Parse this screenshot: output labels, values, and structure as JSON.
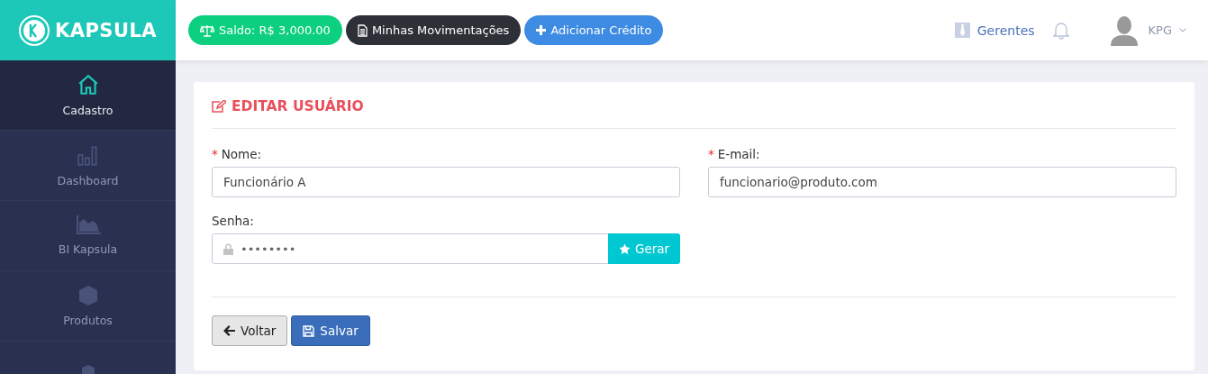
{
  "brand": {
    "name": "KAPSULA"
  },
  "header": {
    "buttons": [
      {
        "kind": "balance",
        "label": "Saldo: R$ 3,000.00"
      },
      {
        "kind": "statement",
        "label": "Minhas Movimentações"
      },
      {
        "kind": "credit",
        "label": "Adicionar Crédito"
      }
    ],
    "managers": "Gerentes",
    "user": "KPG"
  },
  "sidebar": {
    "items": [
      {
        "kind": "home",
        "label": "Cadastro",
        "selected": true
      },
      {
        "kind": "bars",
        "label": "Dashboard",
        "selected": false
      },
      {
        "kind": "area",
        "label": "BI Kapsula",
        "selected": false
      },
      {
        "kind": "cube",
        "label": "Produtos",
        "selected": false
      },
      {
        "kind": "cubes",
        "selected": false
      }
    ]
  },
  "form": {
    "title": "EDITAR USUÁRIO",
    "fields": [
      {
        "required_mark": "*",
        "label": "Nome:",
        "value": "Funcionário A"
      },
      {
        "required_mark": "*",
        "label": "E-mail:",
        "value": "funcionario@produto.com"
      }
    ],
    "password": {
      "label": "Senha:",
      "value": "••••••••",
      "button": "Gerar"
    },
    "actions": [
      {
        "kind": "back",
        "label": "Voltar"
      },
      {
        "kind": "save",
        "label": "Salvar"
      }
    ]
  }
}
